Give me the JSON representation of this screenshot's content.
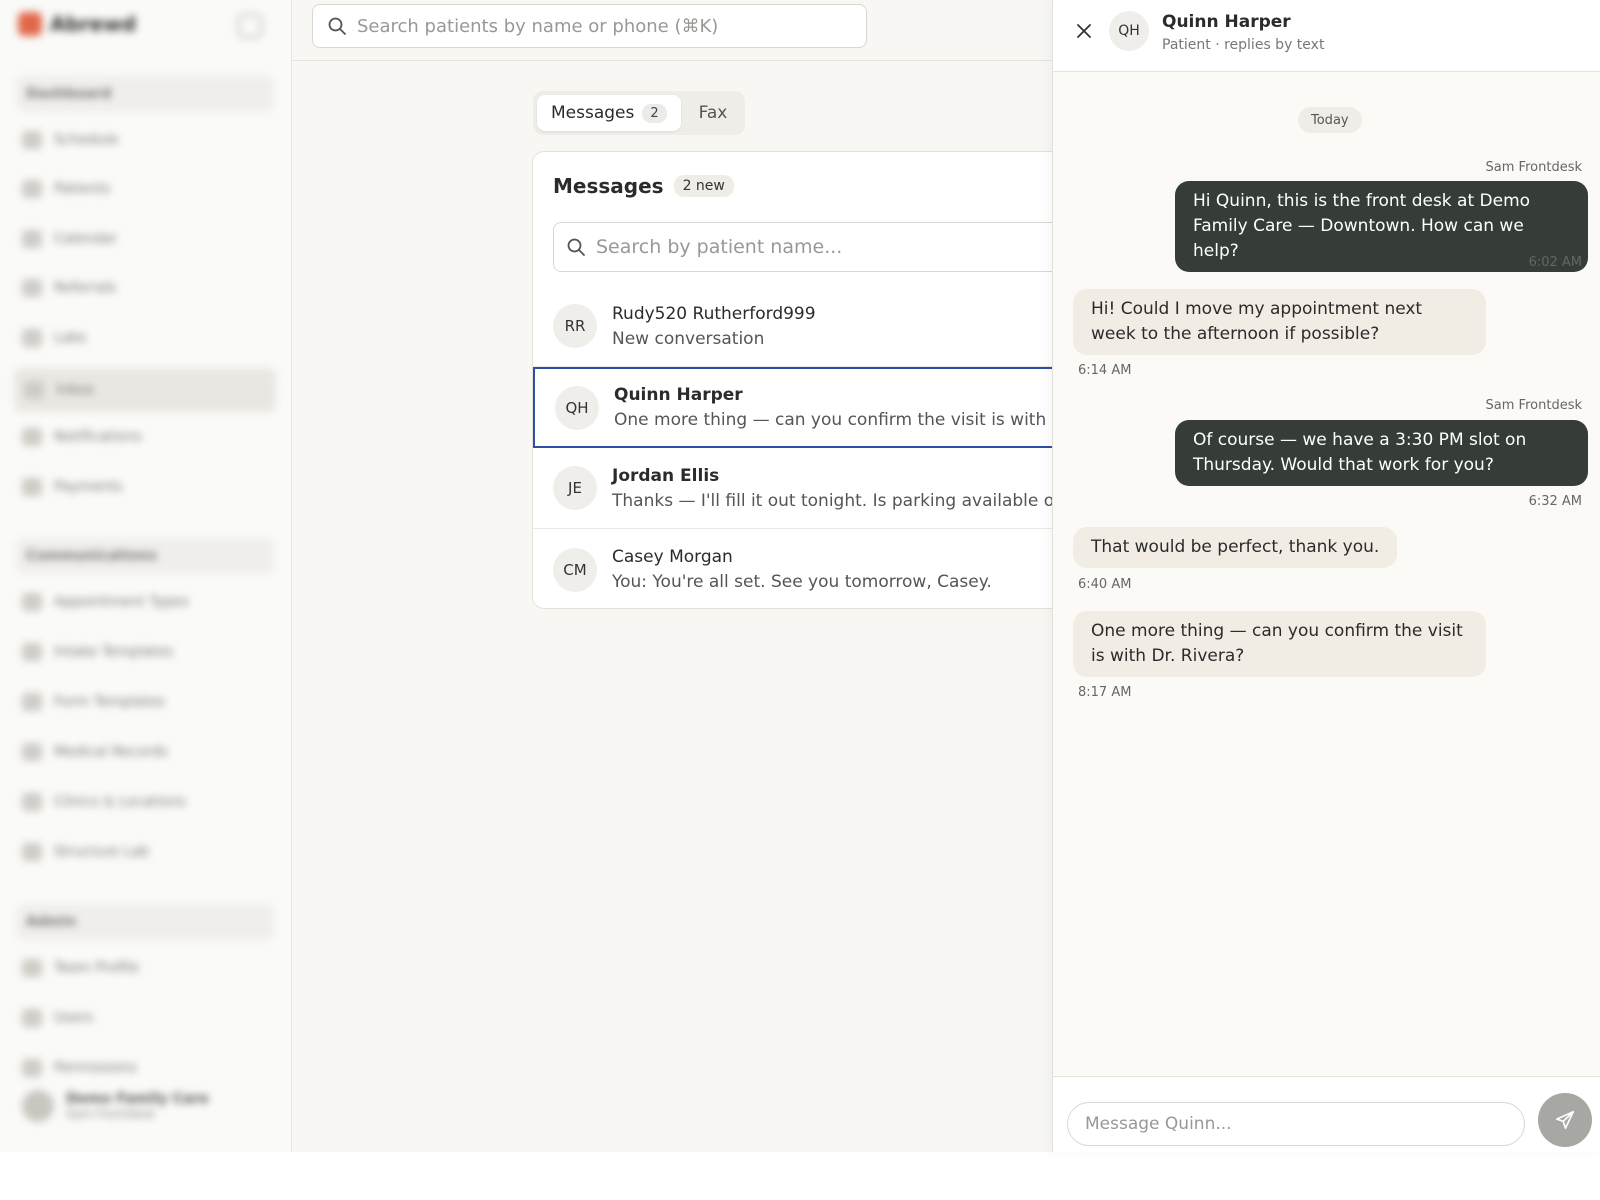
{
  "sidebar": {
    "logo_text": "Abrewd",
    "sections": [
      "Dashboard",
      "Communications",
      "Admin"
    ],
    "items": [
      "Schedule",
      "Patients",
      "Calendar",
      "Referrals",
      "Labs",
      "Inbox",
      "Notifications",
      "Payments",
      "Appointment Types",
      "Intake Templates",
      "Form Templates",
      "Medical Records",
      "Clinics & Locations",
      "Structure Lab",
      "Team Profile",
      "Users",
      "Permissions"
    ],
    "user": {
      "name": "Demo Family Care",
      "sub": "Sam Frontdesk"
    }
  },
  "topbar": {
    "search_placeholder": "Search patients by name or phone (⌘K)"
  },
  "tabs": [
    {
      "label": "Messages",
      "count": "2"
    },
    {
      "label": "Fax"
    }
  ],
  "messages_card": {
    "title": "Messages",
    "new_badge": "2 new",
    "search_placeholder": "Search by patient name...",
    "conversations": [
      {
        "initials": "RR",
        "name": "Rudy520 Rutherford999",
        "preview": "New conversation"
      },
      {
        "initials": "QH",
        "name": "Quinn Harper",
        "preview": "One more thing — can you confirm the visit is with Dr. Rivera?"
      },
      {
        "initials": "JE",
        "name": "Jordan Ellis",
        "preview": "Thanks — I'll fill it out tonight. Is parking available on-site?"
      },
      {
        "initials": "CM",
        "name": "Casey Morgan",
        "preview": "You: You're all set. See you tomorrow, Casey."
      }
    ]
  },
  "chat": {
    "initials": "QH",
    "name": "Quinn Harper",
    "subtitle": "Patient · replies by text",
    "day_label": "Today",
    "messages": [
      {
        "sender": "Sam Frontdesk",
        "text": "Hi Quinn, this is the front desk at Demo Family Care — Downtown. How can we help?",
        "time": "6:02 AM"
      },
      {
        "text": "Hi! Could I move my appointment next week to the afternoon if possible?",
        "time": "6:14 AM"
      },
      {
        "sender": "Sam Frontdesk",
        "text": "Of course — we have a 3:30 PM slot on Thursday. Would that work for you?",
        "time": "6:32 AM"
      },
      {
        "text": "That would be perfect, thank you.",
        "time": "6:40 AM"
      },
      {
        "text": "One more thing — can you confirm the visit is with Dr. Rivera?",
        "time": "8:17 AM"
      }
    ],
    "composer_placeholder": "Message Quinn..."
  }
}
